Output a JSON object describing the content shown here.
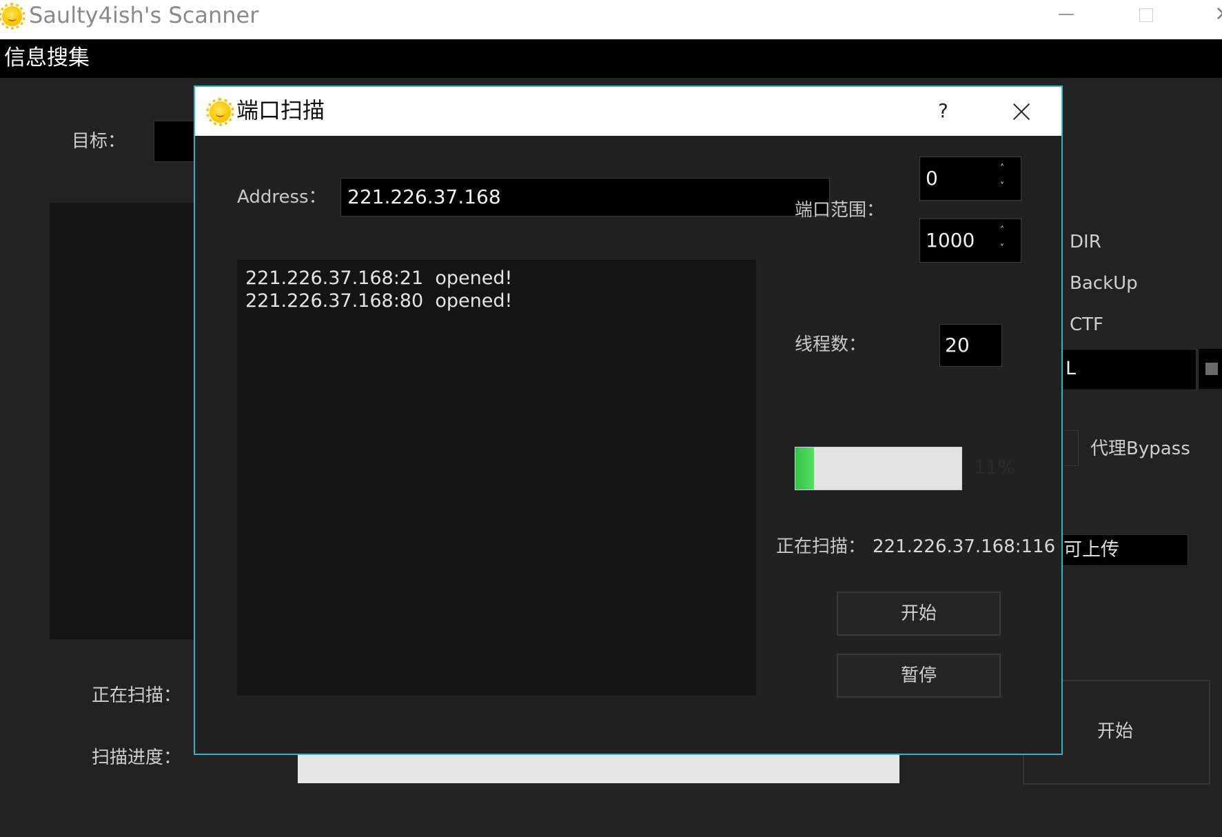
{
  "app": {
    "title": "Saulty4ish's Scanner",
    "menu": [
      "信息搜集"
    ]
  },
  "background": {
    "target_label": "目标：",
    "scanning_label": "正在扫描：",
    "progress_label": "扫描进度：",
    "options": [
      "DIR",
      "BackUp",
      "CTF"
    ],
    "url_partial": "L",
    "proxy_bypass_label": "代理Bypass",
    "upload_partial": "可上传",
    "start_button": "开始"
  },
  "dialog": {
    "title": "端口扫描",
    "help": "?",
    "address_label": "Address：",
    "address_value": "221.226.37.168",
    "log_lines": [
      "221.226.37.168:21  opened!",
      "221.226.37.168:80  opened!"
    ],
    "port_range_label": "端口范围：",
    "port_start": "0",
    "port_end": "1000",
    "threads_label": "线程数：",
    "threads_value": "20",
    "progress_percent": 11,
    "progress_text": "11%",
    "scanning_label": "正在扫描：",
    "scanning_target": "221.226.37.168:116",
    "start_button": "开始",
    "pause_button": "暂停"
  },
  "colors": {
    "accent": "#2fb3c9",
    "progress_green": "#4fd65a",
    "background": "#222222"
  }
}
